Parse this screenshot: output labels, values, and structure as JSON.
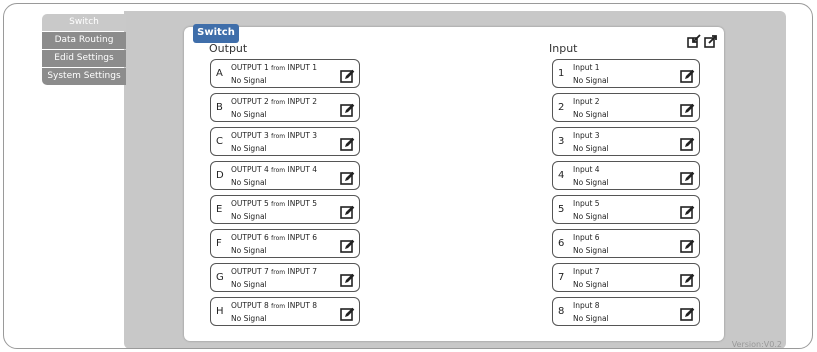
{
  "sidebar": {
    "items": [
      {
        "label": "Switch",
        "active": true
      },
      {
        "label": "Data Routing",
        "active": false
      },
      {
        "label": "Edid Settings",
        "active": false
      },
      {
        "label": "System Settings",
        "active": false
      }
    ]
  },
  "panel": {
    "tab_label": "Switch",
    "output_title": "Output",
    "input_title": "Input",
    "top_icons": [
      "import-icon",
      "export-icon"
    ]
  },
  "outputs": [
    {
      "letter": "A",
      "output": "OUTPUT 1",
      "from": "from",
      "input": "INPUT 1",
      "status": "No Signal"
    },
    {
      "letter": "B",
      "output": "OUTPUT 2",
      "from": "from",
      "input": "INPUT 2",
      "status": "No Signal"
    },
    {
      "letter": "C",
      "output": "OUTPUT 3",
      "from": "from",
      "input": "INPUT 3",
      "status": "No Signal"
    },
    {
      "letter": "D",
      "output": "OUTPUT 4",
      "from": "from",
      "input": "INPUT 4",
      "status": "No Signal"
    },
    {
      "letter": "E",
      "output": "OUTPUT 5",
      "from": "from",
      "input": "INPUT 5",
      "status": "No Signal"
    },
    {
      "letter": "F",
      "output": "OUTPUT 6",
      "from": "from",
      "input": "INPUT 6",
      "status": "No Signal"
    },
    {
      "letter": "G",
      "output": "OUTPUT 7",
      "from": "from",
      "input": "INPUT 7",
      "status": "No Signal"
    },
    {
      "letter": "H",
      "output": "OUTPUT 8",
      "from": "from",
      "input": "INPUT 8",
      "status": "No Signal"
    }
  ],
  "inputs": [
    {
      "number": "1",
      "name": "Input 1",
      "status": "No Signal"
    },
    {
      "number": "2",
      "name": "Input 2",
      "status": "No Signal"
    },
    {
      "number": "3",
      "name": "Input 3",
      "status": "No Signal"
    },
    {
      "number": "4",
      "name": "Input 4",
      "status": "No Signal"
    },
    {
      "number": "5",
      "name": "Input 5",
      "status": "No Signal"
    },
    {
      "number": "6",
      "name": "Input 6",
      "status": "No Signal"
    },
    {
      "number": "7",
      "name": "Input 7",
      "status": "No Signal"
    },
    {
      "number": "8",
      "name": "Input 8",
      "status": "No Signal"
    }
  ],
  "version": "Version:V0.2",
  "colors": {
    "accent": "#3f6eaa",
    "nav": "#8c8c8c",
    "nav_active": "#c9c9c9",
    "main_bg": "#c8c8c8"
  }
}
